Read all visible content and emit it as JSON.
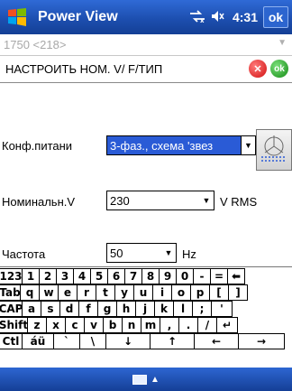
{
  "titlebar": {
    "title": "Power View",
    "time": "4:31",
    "ok": "ok"
  },
  "greyrow": {
    "text": "1750 <218>"
  },
  "setrow": {
    "title": "НАСТРОИТЬ НОМ. V/ F/ТИП",
    "ok_icon": "ok"
  },
  "form": {
    "supply": {
      "label": "Конф.питани",
      "value": "3-фаз., схема 'звез"
    },
    "voltage": {
      "label": "Номинальн.V",
      "value": "230",
      "unit": "V RMS"
    },
    "frequency": {
      "label": "Частота",
      "value": "50",
      "unit": "Hz"
    }
  },
  "keyboard": {
    "rows": [
      [
        "123",
        "1",
        "2",
        "3",
        "4",
        "5",
        "6",
        "7",
        "8",
        "9",
        "0",
        "-",
        "=",
        "⬅"
      ],
      [
        "Tab",
        "q",
        "w",
        "e",
        "r",
        "t",
        "y",
        "u",
        "i",
        "o",
        "p",
        "[",
        "]"
      ],
      [
        "CAP",
        "a",
        "s",
        "d",
        "f",
        "g",
        "h",
        "j",
        "k",
        "l",
        ";",
        "'"
      ],
      [
        "Shift",
        "z",
        "x",
        "c",
        "v",
        "b",
        "n",
        "m",
        ",",
        ".",
        "/",
        "↵"
      ],
      [
        "Ctl",
        "áü",
        "`",
        "\\",
        "↓",
        "↑",
        "←",
        "→"
      ]
    ]
  },
  "colors": {
    "titlebar": "#1d4fb0",
    "selection": "#2a5bd6",
    "cancel": "#d11010",
    "ok": "#138a13"
  },
  "icons": {
    "start": "windows-logo-icon",
    "connectivity": "connectivity-icon",
    "volume": "speaker-icon",
    "schema": "star-connection-icon",
    "keyboard": "keyboard-icon"
  }
}
